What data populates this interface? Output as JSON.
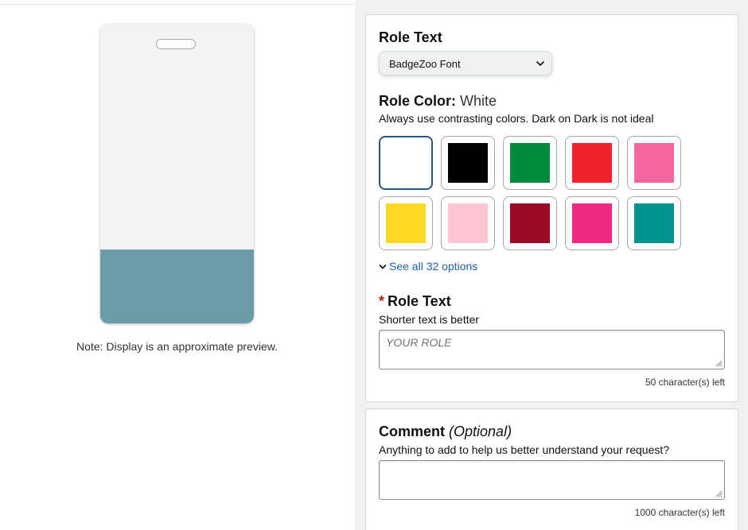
{
  "preview": {
    "note": "Note: Display is an approximate preview.",
    "badge_color": "#f3f3f3",
    "band_color": "#6b9ca8"
  },
  "role_font": {
    "heading": "Role Text",
    "selected": "BadgeZoo Font"
  },
  "role_color": {
    "heading": "Role Color:",
    "selected_name": "White",
    "hint": "Always use contrasting colors. Dark on Dark is not ideal",
    "swatches": [
      {
        "name": "White",
        "hex": "#ffffff",
        "selected": true
      },
      {
        "name": "Black",
        "hex": "#000000",
        "selected": false
      },
      {
        "name": "Green",
        "hex": "#008a3e",
        "selected": false
      },
      {
        "name": "Red",
        "hex": "#f0222b",
        "selected": false
      },
      {
        "name": "Pink",
        "hex": "#f5679e",
        "selected": false
      },
      {
        "name": "Yellow",
        "hex": "#ffd725",
        "selected": false
      },
      {
        "name": "Light Pink",
        "hex": "#fec5d3",
        "selected": false
      },
      {
        "name": "Maroon",
        "hex": "#990a25",
        "selected": false
      },
      {
        "name": "Hot Pink",
        "hex": "#f02a82",
        "selected": false
      },
      {
        "name": "Teal",
        "hex": "#00928f",
        "selected": false
      }
    ],
    "see_all": "See all 32 options"
  },
  "role_text": {
    "required_mark": "*",
    "heading": "Role Text",
    "hint": "Shorter text is better",
    "placeholder": "YOUR ROLE",
    "counter": "50 character(s) left"
  },
  "comment": {
    "heading": "Comment",
    "optional": "(Optional)",
    "hint": "Anything to add to help us better understand your request?",
    "counter": "1000 character(s) left"
  },
  "icons": {
    "select_chevron": "chevron-down-icon",
    "see_all_chevron": "chevron-down-icon",
    "resize_grip": "resize-grip-icon"
  }
}
